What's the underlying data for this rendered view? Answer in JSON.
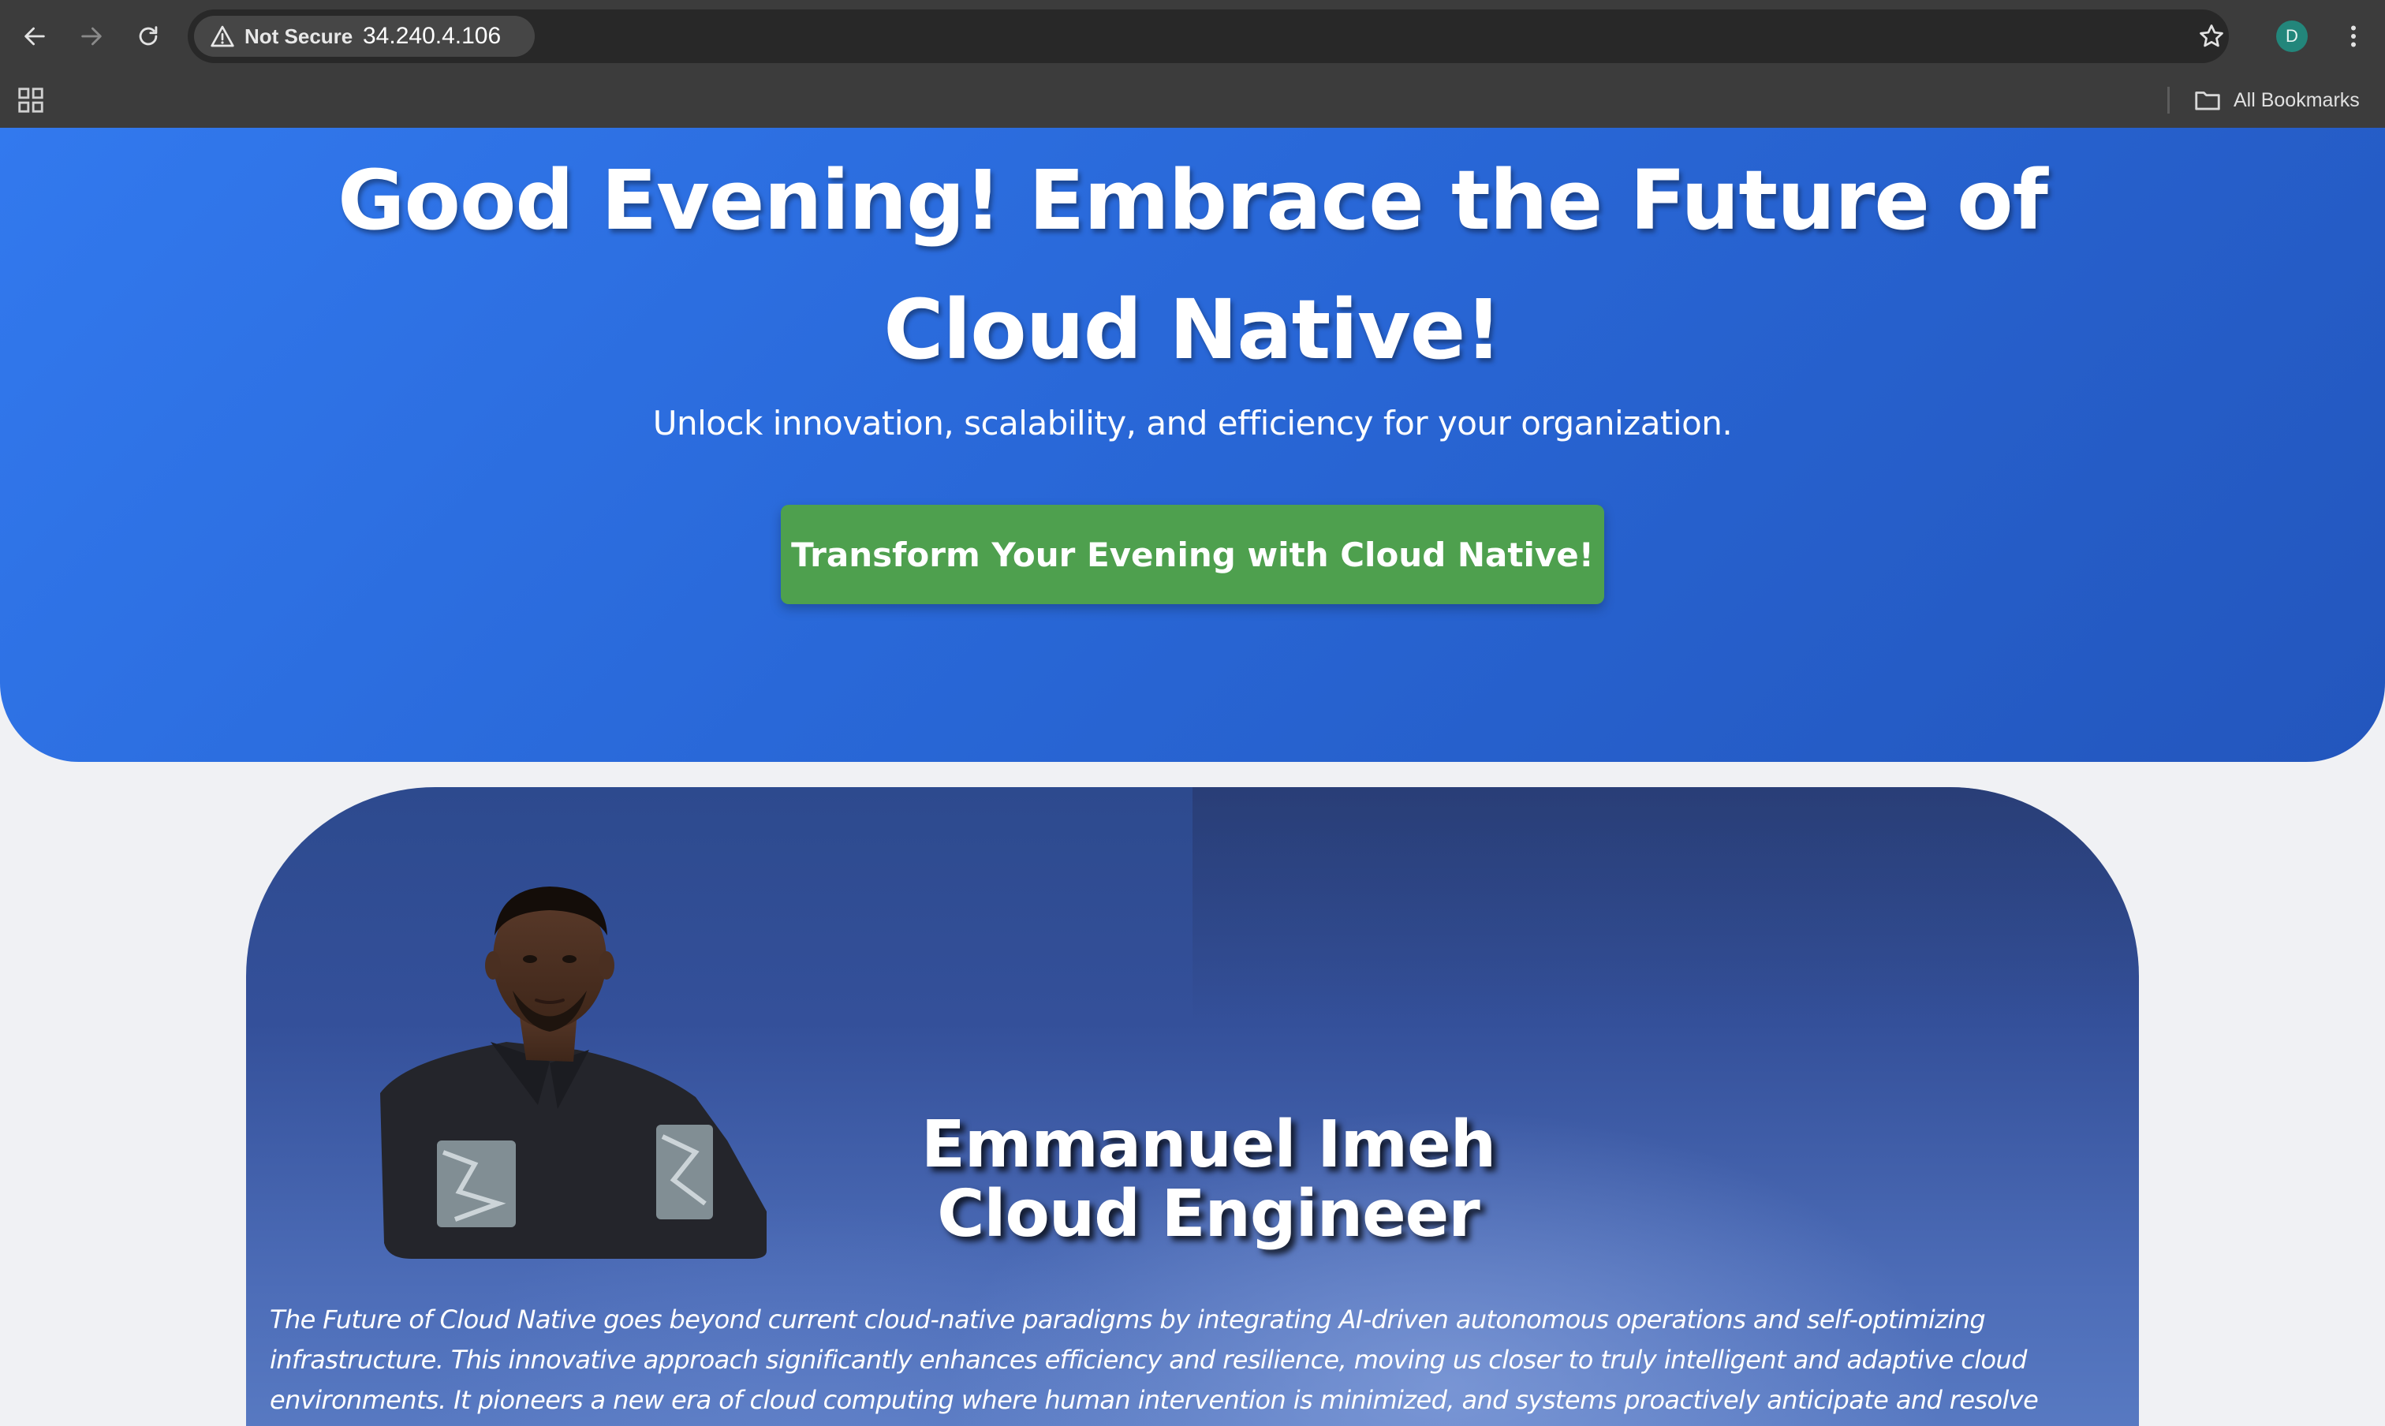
{
  "browser": {
    "security_label": "Not Secure",
    "url": "34.240.4.106",
    "profile_initial": "D",
    "bookmarks_label": "All Bookmarks"
  },
  "hero": {
    "title": "Good Evening! Embrace the Future of Cloud Native!",
    "subtitle": "Unlock innovation, scalability, and efficiency for your organization.",
    "cta_label": "Transform Your Evening with Cloud Native!"
  },
  "profile": {
    "name": "Emmanuel Imeh",
    "role": "Cloud Engineer",
    "description": "The Future of Cloud Native goes beyond current cloud-native paradigms by integrating AI-driven autonomous operations and self-optimizing infrastructure. This innovative approach significantly enhances efficiency and resilience, moving us closer to truly intelligent and adaptive cloud environments. It pioneers a new era of cloud computing where human intervention is minimized, and systems proactively anticipate and resolve issues."
  },
  "colors": {
    "hero_gradient_start": "#3279ee",
    "hero_gradient_end": "#2356bd",
    "cta_green": "#4ea04e",
    "card_blue": "#34509a",
    "page_background": "#f0f1f4",
    "chrome_dark": "#3c3c3c"
  },
  "icons": {
    "back": "arrow-left-icon",
    "forward": "arrow-right-icon",
    "reload": "reload-icon",
    "warning": "warning-triangle-icon",
    "star": "star-icon",
    "menu": "kebab-menu-icon",
    "apps": "apps-grid-icon",
    "folder": "folder-icon"
  }
}
